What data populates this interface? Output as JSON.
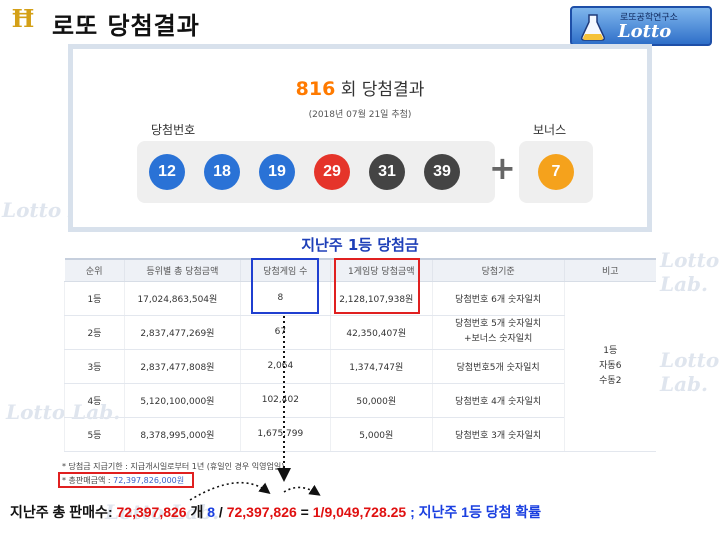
{
  "header": {
    "logo_icon": "lotto-symbol-icon",
    "logo_glyph": "Ħ",
    "title": "로또 당첨결과",
    "brand_subtitle": "로또공학연구소",
    "brand_name": "Lotto Lab."
  },
  "watermark_text": "Lotto Lab.",
  "result": {
    "round": "816",
    "round_suffix": "회 당첨결과",
    "draw_date": "(2018년 07월 21일 추첨)",
    "winning_label": "당첨번호",
    "bonus_label": "보너스",
    "numbers": [
      "12",
      "18",
      "19",
      "29",
      "31",
      "39"
    ],
    "bonus": "7",
    "plus": "+",
    "ball_colors": {
      "blue": "#2a72d6",
      "red": "#e5342a",
      "dark": "#444444",
      "orange": "#f5a21c"
    }
  },
  "table": {
    "title": "지난주 1등 당첨금",
    "headers": [
      "순위",
      "등위별 총 당첨금액",
      "당첨게임 수",
      "1게임당 당첨금액",
      "당첨기준",
      "비고"
    ],
    "rows": [
      {
        "rank": "1등",
        "total": "17,024,863,504원",
        "winners": "8",
        "per_game": "2,128,107,938원",
        "criteria": "당첨번호 6개 숫자일치"
      },
      {
        "rank": "2등",
        "total": "2,837,477,269원",
        "winners": "67",
        "per_game": "42,350,407원",
        "criteria": "당첨번호 5개 숫자일치",
        "criteria2": "+보너스 숫자일치"
      },
      {
        "rank": "3등",
        "total": "2,837,477,808원",
        "winners": "2,064",
        "per_game": "1,374,747원",
        "criteria": "당첨번호5개 숫자일치"
      },
      {
        "rank": "4등",
        "total": "5,120,100,000원",
        "winners": "102,402",
        "per_game": "50,000원",
        "criteria": "당첨번호 4개 숫자일치"
      },
      {
        "rank": "5등",
        "total": "8,378,995,000원",
        "winners": "1,675,799",
        "per_game": "5,000원",
        "criteria": "당첨번호 3개 숫자일치"
      }
    ],
    "note_lines": [
      "1등",
      "자동6",
      "수동2"
    ]
  },
  "footer": {
    "note": "* 당첨금 지급기한 : 지급개시일로부터 1년 (휴일인 경우 익영업일)",
    "sales_label": "* 총판매금액 : ",
    "sales_value": "72,397,826,000원"
  },
  "summary": {
    "label": "지난주 총 판매수: ",
    "sales": "72,397,826",
    "unit": " 개 ",
    "winners": "8",
    "slash": " / ",
    "sales2": "72,397,826",
    "equals": " = ",
    "probability": "1/9,049,728.25",
    "tail": " ; 지난주 1등 당첨 확률"
  }
}
